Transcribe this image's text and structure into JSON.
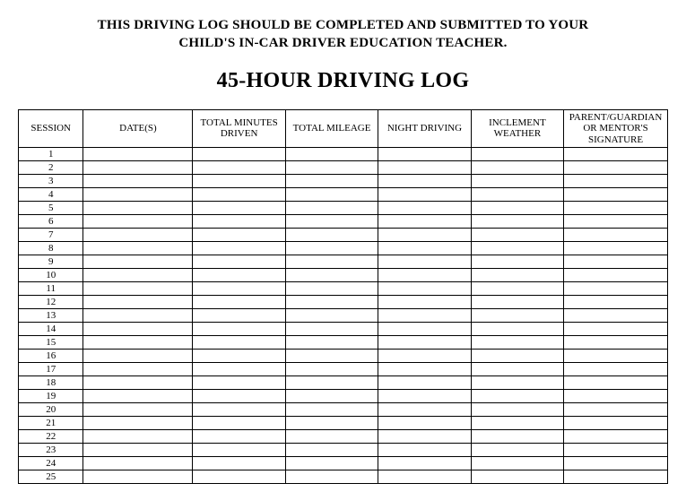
{
  "header_instruction_line1": "THIS DRIVING LOG SHOULD BE COMPLETED AND SUBMITTED TO YOUR",
  "header_instruction_line2": "CHILD'S IN-CAR DRIVER EDUCATION TEACHER.",
  "main_title": "45-HOUR DRIVING LOG",
  "columns": {
    "session": "SESSION",
    "dates": "DATE(S)",
    "total_minutes": "TOTAL MINUTES DRIVEN",
    "total_mileage": "TOTAL MILEAGE",
    "night_driving": "NIGHT DRIVING",
    "inclement": "INCLEMENT WEATHER",
    "signature": "PARENT/GUARDIAN OR MENTOR'S SIGNATURE"
  },
  "rows": [
    {
      "session": "1",
      "dates": "",
      "total_minutes": "",
      "total_mileage": "",
      "night_driving": "",
      "inclement": "",
      "signature": ""
    },
    {
      "session": "2",
      "dates": "",
      "total_minutes": "",
      "total_mileage": "",
      "night_driving": "",
      "inclement": "",
      "signature": ""
    },
    {
      "session": "3",
      "dates": "",
      "total_minutes": "",
      "total_mileage": "",
      "night_driving": "",
      "inclement": "",
      "signature": ""
    },
    {
      "session": "4",
      "dates": "",
      "total_minutes": "",
      "total_mileage": "",
      "night_driving": "",
      "inclement": "",
      "signature": ""
    },
    {
      "session": "5",
      "dates": "",
      "total_minutes": "",
      "total_mileage": "",
      "night_driving": "",
      "inclement": "",
      "signature": ""
    },
    {
      "session": "6",
      "dates": "",
      "total_minutes": "",
      "total_mileage": "",
      "night_driving": "",
      "inclement": "",
      "signature": ""
    },
    {
      "session": "7",
      "dates": "",
      "total_minutes": "",
      "total_mileage": "",
      "night_driving": "",
      "inclement": "",
      "signature": ""
    },
    {
      "session": "8",
      "dates": "",
      "total_minutes": "",
      "total_mileage": "",
      "night_driving": "",
      "inclement": "",
      "signature": ""
    },
    {
      "session": "9",
      "dates": "",
      "total_minutes": "",
      "total_mileage": "",
      "night_driving": "",
      "inclement": "",
      "signature": ""
    },
    {
      "session": "10",
      "dates": "",
      "total_minutes": "",
      "total_mileage": "",
      "night_driving": "",
      "inclement": "",
      "signature": ""
    },
    {
      "session": "11",
      "dates": "",
      "total_minutes": "",
      "total_mileage": "",
      "night_driving": "",
      "inclement": "",
      "signature": ""
    },
    {
      "session": "12",
      "dates": "",
      "total_minutes": "",
      "total_mileage": "",
      "night_driving": "",
      "inclement": "",
      "signature": ""
    },
    {
      "session": "13",
      "dates": "",
      "total_minutes": "",
      "total_mileage": "",
      "night_driving": "",
      "inclement": "",
      "signature": ""
    },
    {
      "session": "14",
      "dates": "",
      "total_minutes": "",
      "total_mileage": "",
      "night_driving": "",
      "inclement": "",
      "signature": ""
    },
    {
      "session": "15",
      "dates": "",
      "total_minutes": "",
      "total_mileage": "",
      "night_driving": "",
      "inclement": "",
      "signature": ""
    },
    {
      "session": "16",
      "dates": "",
      "total_minutes": "",
      "total_mileage": "",
      "night_driving": "",
      "inclement": "",
      "signature": ""
    },
    {
      "session": "17",
      "dates": "",
      "total_minutes": "",
      "total_mileage": "",
      "night_driving": "",
      "inclement": "",
      "signature": ""
    },
    {
      "session": "18",
      "dates": "",
      "total_minutes": "",
      "total_mileage": "",
      "night_driving": "",
      "inclement": "",
      "signature": ""
    },
    {
      "session": "19",
      "dates": "",
      "total_minutes": "",
      "total_mileage": "",
      "night_driving": "",
      "inclement": "",
      "signature": ""
    },
    {
      "session": "20",
      "dates": "",
      "total_minutes": "",
      "total_mileage": "",
      "night_driving": "",
      "inclement": "",
      "signature": ""
    },
    {
      "session": "21",
      "dates": "",
      "total_minutes": "",
      "total_mileage": "",
      "night_driving": "",
      "inclement": "",
      "signature": ""
    },
    {
      "session": "22",
      "dates": "",
      "total_minutes": "",
      "total_mileage": "",
      "night_driving": "",
      "inclement": "",
      "signature": ""
    },
    {
      "session": "23",
      "dates": "",
      "total_minutes": "",
      "total_mileage": "",
      "night_driving": "",
      "inclement": "",
      "signature": ""
    },
    {
      "session": "24",
      "dates": "",
      "total_minutes": "",
      "total_mileage": "",
      "night_driving": "",
      "inclement": "",
      "signature": ""
    },
    {
      "session": "25",
      "dates": "",
      "total_minutes": "",
      "total_mileage": "",
      "night_driving": "",
      "inclement": "",
      "signature": ""
    }
  ]
}
